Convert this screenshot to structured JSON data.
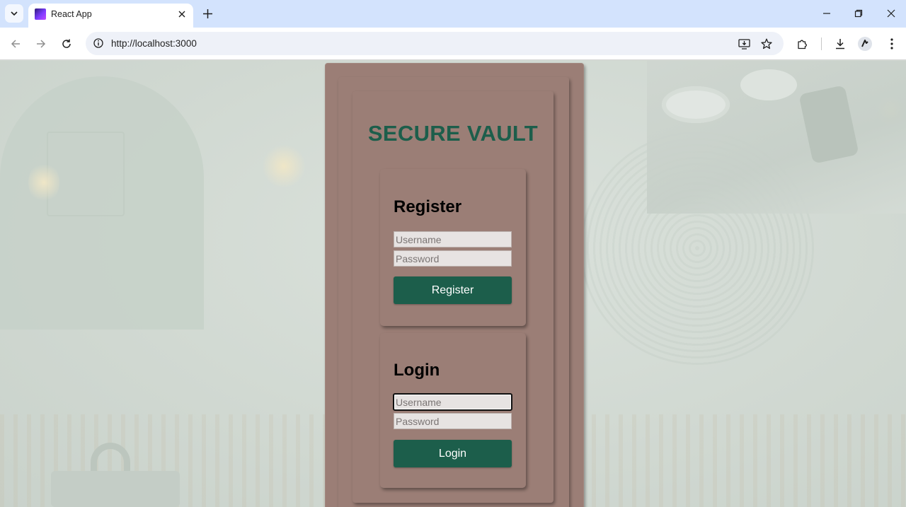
{
  "browser": {
    "tab_title": "React App",
    "url": "http://localhost:3000"
  },
  "app": {
    "title": "SECURE VAULT",
    "register": {
      "heading": "Register",
      "username_placeholder": "Username",
      "password_placeholder": "Password",
      "button_label": "Register"
    },
    "login": {
      "heading": "Login",
      "username_placeholder": "Username",
      "password_placeholder": "Password",
      "button_label": "Login"
    }
  },
  "colors": {
    "accent_green": "#1c5e4b",
    "panel_brown": "#9b7e76",
    "chrome_blue": "#d3e3fd"
  },
  "icons": [
    "tab-search-icon",
    "react-favicon-icon",
    "close-icon",
    "plus-icon",
    "minimize-icon",
    "restore-icon",
    "back-arrow-icon",
    "forward-arrow-icon",
    "reload-icon",
    "site-info-icon",
    "install-app-icon",
    "bookmark-star-icon",
    "extensions-icon",
    "download-icon",
    "profile-icon",
    "kebab-menu-icon"
  ]
}
